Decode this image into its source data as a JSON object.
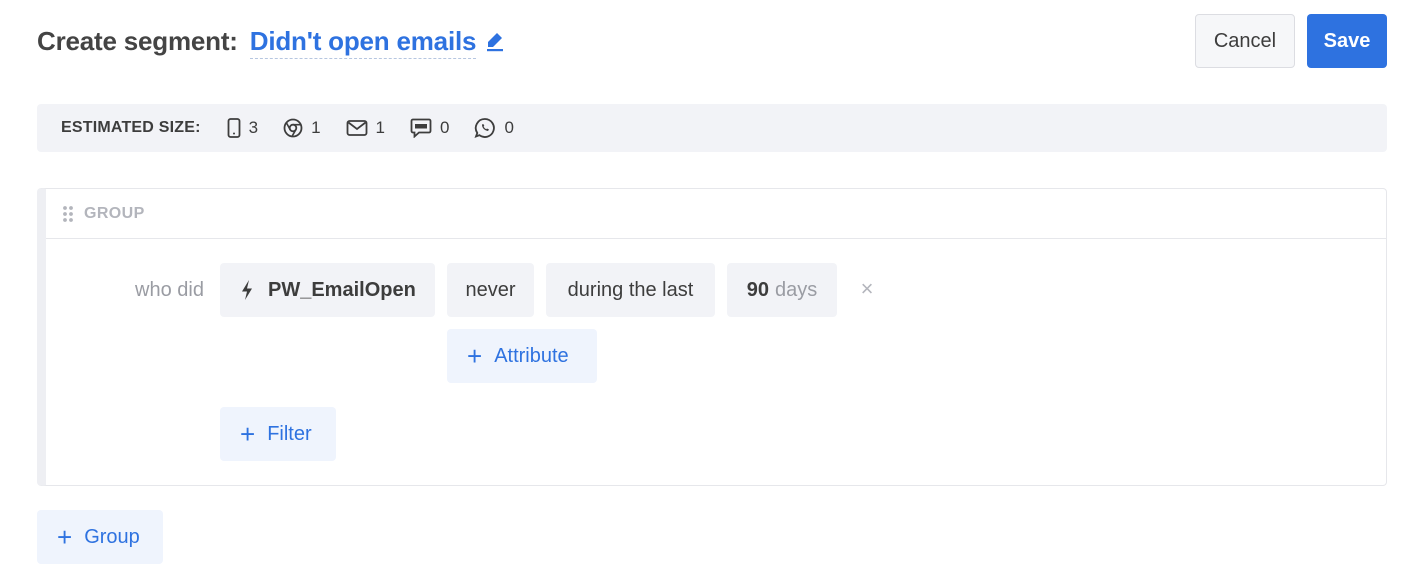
{
  "header": {
    "title_label": "Create segment:",
    "segment_name": "Didn't open emails",
    "cancel_label": "Cancel",
    "save_label": "Save"
  },
  "estimated": {
    "label": "ESTIMATED SIZE:",
    "items": [
      {
        "icon": "mobile-icon",
        "count": "3"
      },
      {
        "icon": "chrome-icon",
        "count": "1"
      },
      {
        "icon": "email-icon",
        "count": "1"
      },
      {
        "icon": "sms-icon",
        "count": "0"
      },
      {
        "icon": "whatsapp-icon",
        "count": "0"
      }
    ]
  },
  "group": {
    "label": "GROUP",
    "condition": {
      "prefix": "who did",
      "event": "PW_EmailOpen",
      "frequency": "never",
      "period": "during the last",
      "amount": "90",
      "unit": "days"
    },
    "add_attribute_label": "Attribute",
    "add_filter_label": "Filter"
  },
  "add_group_label": "Group",
  "colors": {
    "accent": "#2e72e0",
    "chip_bg": "#f2f3f7",
    "add_bg": "#eff4fd"
  }
}
